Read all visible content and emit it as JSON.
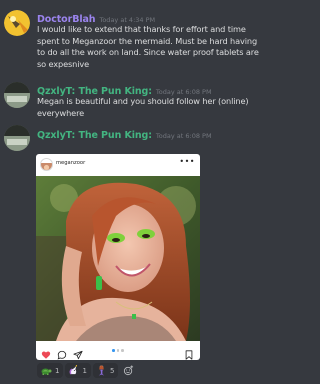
{
  "messages": [
    {
      "username": "DoctorBlah",
      "username_color": "#9b84ee",
      "timestamp": "Today at 4:34 PM",
      "body": "I would like to extend that thanks for effort and time spent to Meganzoor the mermaid. Must be hard having to do all the work on land. Since water proof tablets are so expesnive"
    },
    {
      "username": "QzxlyT: The Pun King:",
      "username_color": "#43b581",
      "timestamp": "Today at 6:08 PM",
      "body": "Megan is beautiful and you should follow her (online) everywhere"
    },
    {
      "username": "QzxlyT: The Pun King:",
      "username_color": "#43b581",
      "timestamp": "Today at 6:08 PM"
    }
  ],
  "embed": {
    "account": "meganzoor",
    "more_icon": "more-horizontal-icon",
    "actions": [
      "heart-icon",
      "comment-icon",
      "share-icon",
      "bookmark-icon"
    ],
    "carousel_pages": 3,
    "carousel_active": 1,
    "colors": {
      "heart": "#ed4956",
      "dot_active": "#3897f0"
    }
  },
  "reactions": [
    {
      "icon": "turtle-emoji-icon",
      "count": "1"
    },
    {
      "icon": "unicorn-emoji-icon",
      "count": "1"
    },
    {
      "icon": "mermaid-emoji-icon",
      "count": "5"
    }
  ],
  "colors": {
    "background": "#36393f",
    "text": "#dcddde",
    "timestamp": "#72767d",
    "reaction_bg": "#2f3136"
  }
}
